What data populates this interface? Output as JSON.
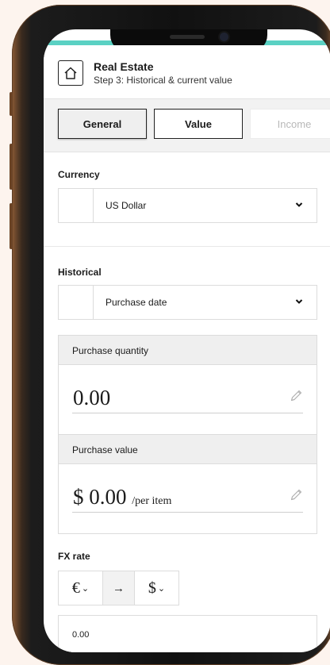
{
  "header": {
    "title": "Real Estate",
    "subtitle": "Step 3: Historical & current value"
  },
  "tabs": [
    {
      "label": "General",
      "state": "selected"
    },
    {
      "label": "Value",
      "state": "default"
    },
    {
      "label": "Income",
      "state": "disabled"
    }
  ],
  "currency": {
    "label": "Currency",
    "selected": "US Dollar"
  },
  "historical": {
    "label": "Historical",
    "selected": "Purchase date"
  },
  "purchase_quantity": {
    "label": "Purchase quantity",
    "value": "0.00"
  },
  "purchase_value": {
    "label": "Purchase value",
    "value": "$ 0.00",
    "unit": "/per item"
  },
  "fx": {
    "label": "FX rate",
    "from_symbol": "€",
    "arrow": "→",
    "to_symbol": "$",
    "value": "0.00"
  },
  "colors": {
    "accent": "#5ad1c3",
    "frame": "#111111",
    "background": "#fdf4ee"
  }
}
